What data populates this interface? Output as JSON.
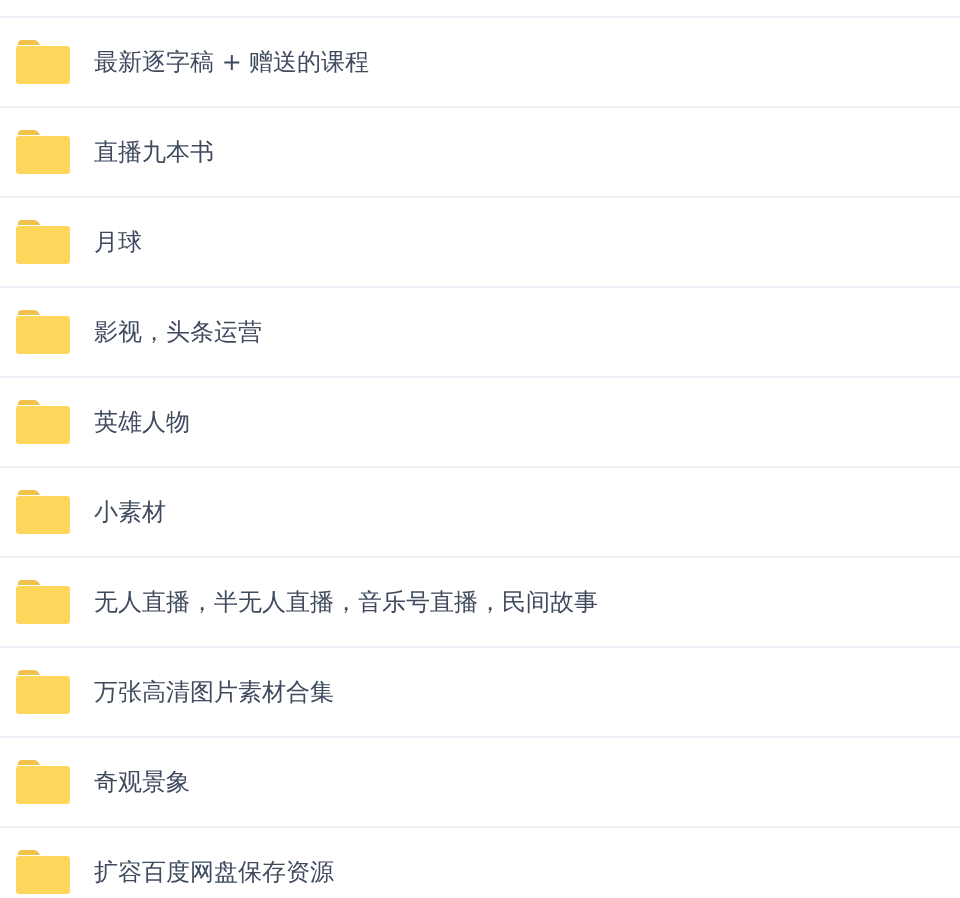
{
  "folders": [
    {
      "name": "最新逐字稿 + 赠送的课程"
    },
    {
      "name": "直播九本书"
    },
    {
      "name": "月球"
    },
    {
      "name": "影视，头条运营"
    },
    {
      "name": "英雄人物"
    },
    {
      "name": "小素材"
    },
    {
      "name": "无人直播，半无人直播，音乐号直播，民间故事"
    },
    {
      "name": "万张高清图片素材合集"
    },
    {
      "name": "奇观景象"
    },
    {
      "name": "扩容百度网盘保存资源"
    }
  ]
}
